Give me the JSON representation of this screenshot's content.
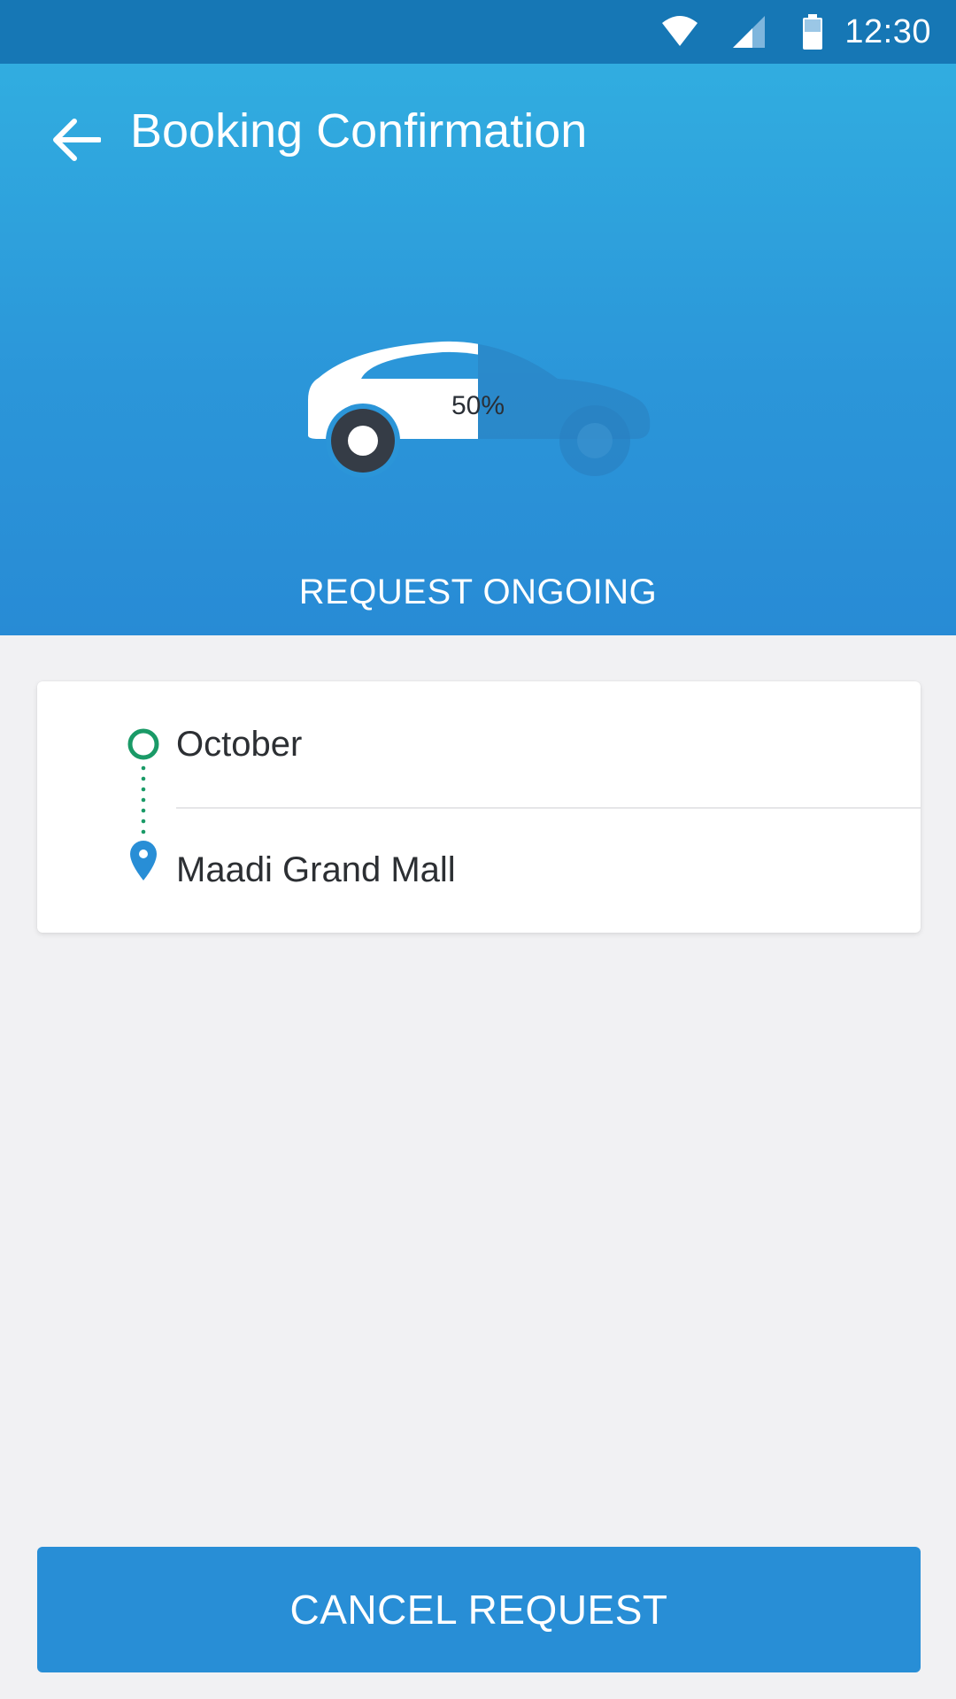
{
  "status_bar": {
    "time": "12:30",
    "icons": [
      "wifi-icon",
      "cellular-signal-icon",
      "battery-icon"
    ]
  },
  "header": {
    "title": "Booking Confirmation",
    "back_icon": "arrow-left-icon",
    "progress_percent": 50,
    "progress_label": "50%",
    "status_text": "REQUEST ONGOING"
  },
  "route": {
    "pickup": "October",
    "dropoff": "Maadi Grand Mall",
    "pickup_icon": "circle-origin-icon",
    "dropoff_icon": "location-pin-icon"
  },
  "actions": {
    "cancel_label": "CANCEL REQUEST"
  },
  "colors": {
    "status_bar": "#1677b5",
    "header_top": "#31ade0",
    "header_bottom": "#288bd5",
    "accent_green": "#1a9a67",
    "accent_blue": "#288ed6",
    "background": "#f1f1f3"
  }
}
